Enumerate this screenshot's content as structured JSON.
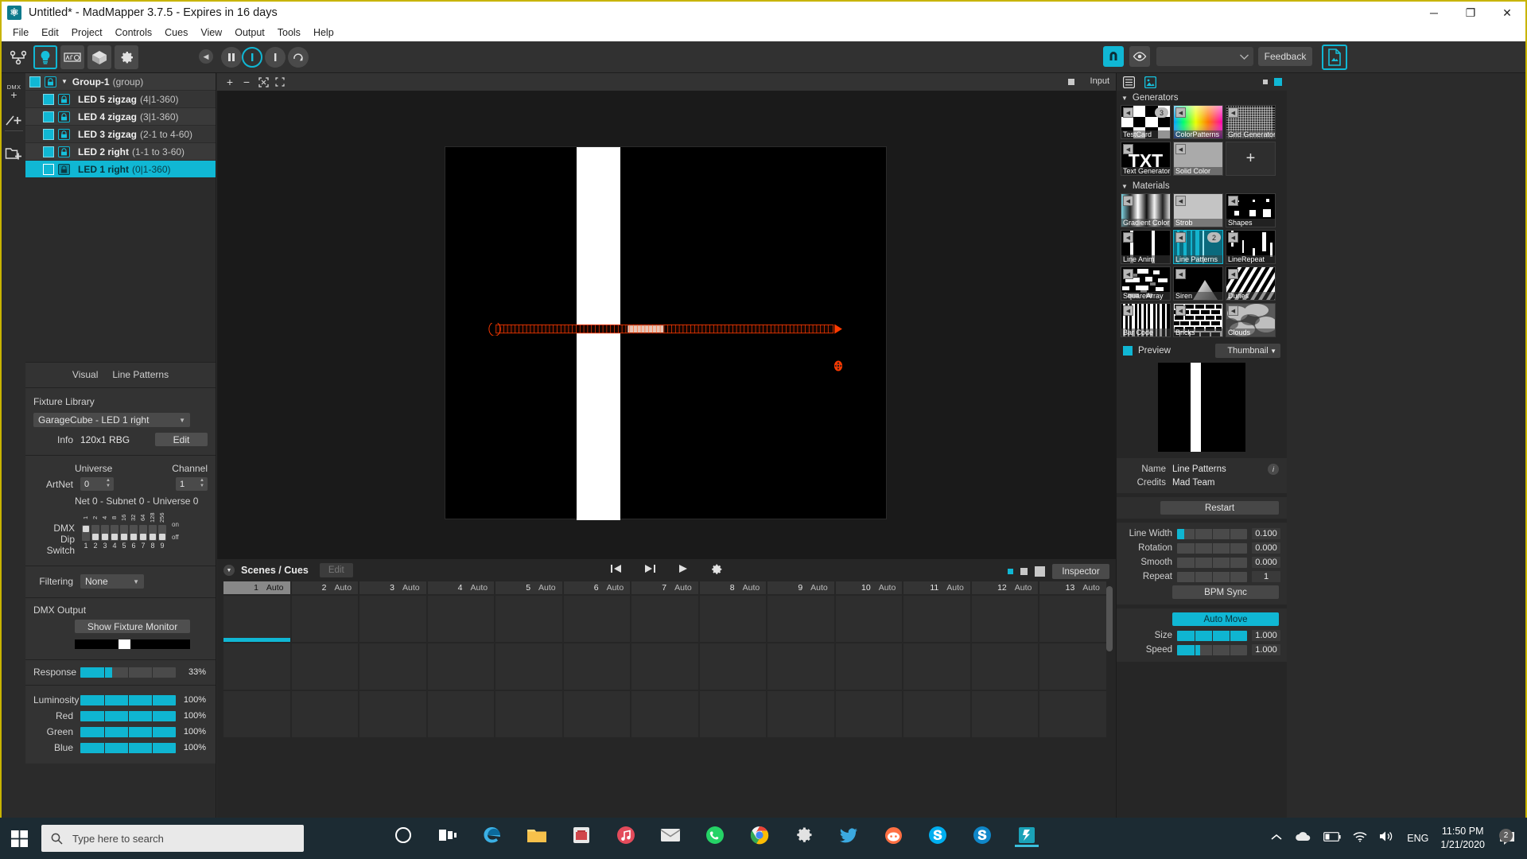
{
  "window": {
    "title": "Untitled* - MadMapper 3.7.5 - Expires in 16 days",
    "icon": "madmapper-icon",
    "minimize": "─",
    "maximize": "❐",
    "close": "✕"
  },
  "menubar": {
    "items": [
      "File",
      "Edit",
      "Project",
      "Controls",
      "Cues",
      "View",
      "Output",
      "Tools",
      "Help"
    ]
  },
  "toolbar": {
    "feedback_label": "Feedback",
    "surface_combo_value": ""
  },
  "fixtures": {
    "rows": [
      {
        "name": "Group-1",
        "meta": "(group)",
        "group": true,
        "selected": false,
        "swatch": true,
        "locked": true
      },
      {
        "name": "LED 5 zigzag",
        "meta": "(4|1-360)",
        "group": false,
        "selected": false,
        "swatch": true,
        "locked": true
      },
      {
        "name": "LED 4 zigzag",
        "meta": "(3|1-360)",
        "group": false,
        "selected": false,
        "swatch": true,
        "locked": true
      },
      {
        "name": "LED 3 zigzag",
        "meta": "(2-1 to 4-60)",
        "group": false,
        "selected": false,
        "swatch": true,
        "locked": true
      },
      {
        "name": "LED 2 right",
        "meta": "(1-1 to 3-60)",
        "group": false,
        "selected": false,
        "swatch": true,
        "locked": true
      },
      {
        "name": "LED 1 right",
        "meta": "(0|1-360)",
        "group": false,
        "selected": true,
        "swatch": false,
        "locked": true
      }
    ]
  },
  "left_panel": {
    "tabs": [
      "Visual",
      "Line Patterns"
    ],
    "fixture_library_label": "Fixture Library",
    "fixture_library_value": "GarageCube - LED 1 right",
    "info_label": "Info",
    "info_value": "120x1 RBG",
    "edit_label": "Edit",
    "universe_label": "Universe",
    "channel_label": "Channel",
    "artnet_label": "ArtNet",
    "universe_value": "0",
    "channel_value": "1",
    "net_info": "Net 0 - Subnet 0 - Universe 0",
    "dmx_label_line1": "DMX",
    "dmx_label_line2": "Dip Switch",
    "dip_values": [
      "1",
      "2",
      "4",
      "8",
      "16",
      "32",
      "64",
      "128",
      "256"
    ],
    "dip_numbers": [
      "1",
      "2",
      "3",
      "4",
      "5",
      "6",
      "7",
      "8",
      "9"
    ],
    "dip_states": [
      "up",
      "down",
      "down",
      "down",
      "down",
      "down",
      "down",
      "down",
      "down"
    ],
    "dip_on": "on",
    "dip_off": "off",
    "filtering_label": "Filtering",
    "filtering_value": "None",
    "dmx_output_label": "DMX Output",
    "show_fixture_monitor": "Show Fixture Monitor",
    "response_label": "Response",
    "response_value": "33%",
    "response_pct": 33,
    "sliders": [
      {
        "label": "Luminosity",
        "value": "100%",
        "pct": 100
      },
      {
        "label": "Red",
        "value": "100%",
        "pct": 100
      },
      {
        "label": "Green",
        "value": "100%",
        "pct": 100
      },
      {
        "label": "Blue",
        "value": "100%",
        "pct": 100
      }
    ]
  },
  "canvas": {
    "input_label": "Input",
    "zoom_in": "+",
    "zoom_out": "−"
  },
  "scenes": {
    "title": "Scenes / Cues",
    "edit_label": "Edit",
    "inspector_label": "Inspector",
    "auto_label": "Auto",
    "cues": [
      "1",
      "2",
      "3",
      "4",
      "5",
      "6",
      "7",
      "8",
      "9",
      "10",
      "11",
      "12",
      "13"
    ],
    "active_cue": "1"
  },
  "right_panel": {
    "generators_label": "Generators",
    "materials_label": "Materials",
    "generators": [
      {
        "label": "TestCard",
        "badge": "3",
        "selected": false
      },
      {
        "label": "ColorPatterns",
        "badge": "",
        "selected": false
      },
      {
        "label": "Grid Generator",
        "badge": "",
        "selected": false
      },
      {
        "label": "Text Generator",
        "badge": "",
        "selected": false
      },
      {
        "label": "Solid Color",
        "badge": "",
        "selected": false
      },
      {
        "label": "",
        "badge": "",
        "selected": false,
        "add": true
      }
    ],
    "materials": [
      {
        "label": "Gradient Color",
        "badge": "",
        "selected": false
      },
      {
        "label": "Strob",
        "badge": "",
        "selected": false
      },
      {
        "label": "Shapes",
        "badge": "",
        "selected": false
      },
      {
        "label": "Line Anim",
        "badge": "",
        "selected": false
      },
      {
        "label": "Line Patterns",
        "badge": "2",
        "selected": true
      },
      {
        "label": "LineRepeat",
        "badge": "",
        "selected": false
      },
      {
        "label": "SquareArray",
        "badge": "",
        "selected": false
      },
      {
        "label": "Siren",
        "badge": "",
        "selected": false
      },
      {
        "label": "Dunes",
        "badge": "",
        "selected": false
      },
      {
        "label": "Bar Code",
        "badge": "",
        "selected": false
      },
      {
        "label": "Bricks",
        "badge": "",
        "selected": false
      },
      {
        "label": "Clouds",
        "badge": "",
        "selected": false
      }
    ],
    "preview_label": "Preview",
    "preview_mode": "Thumbnail",
    "name_label": "Name",
    "name_value": "Line Patterns",
    "credits_label": "Credits",
    "credits_value": "Mad Team",
    "restart_label": "Restart",
    "params": [
      {
        "label": "Line Width",
        "value": "0.100",
        "pct": 10
      },
      {
        "label": "Rotation",
        "value": "0.000",
        "pct": 0
      },
      {
        "label": "Smooth",
        "value": "0.000",
        "pct": 0
      },
      {
        "label": "Repeat",
        "value": "1",
        "pct": 0
      }
    ],
    "bpm_sync_label": "BPM Sync",
    "auto_move_label": "Auto Move",
    "move_params": [
      {
        "label": "Size",
        "value": "1.000",
        "pct": 100
      },
      {
        "label": "Speed",
        "value": "1.000",
        "pct": 33
      }
    ]
  },
  "taskbar": {
    "search_placeholder": "Type here to search",
    "language": "ENG",
    "time": "11:50 PM",
    "date": "1/21/2020",
    "notification_count": "2"
  }
}
